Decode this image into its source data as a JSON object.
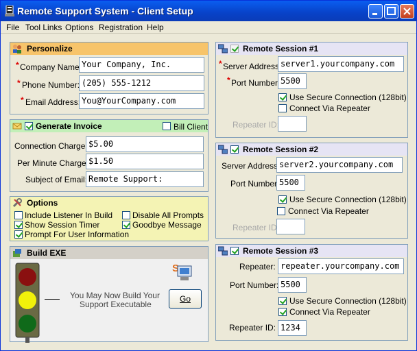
{
  "window": {
    "title": "Remote Support System - Client Setup"
  },
  "menu": [
    "File",
    "Tool Links",
    "Options",
    "Registration",
    "Help"
  ],
  "personalize": {
    "title": "Personalize",
    "company_label": "Company Name:",
    "company_value": "Your Company, Inc.",
    "phone_label": "Phone Number:",
    "phone_value": "(205) 555-1212",
    "email_label": "Email Address:",
    "email_value": "You@YourCompany.com"
  },
  "invoice": {
    "title": "Generate Invoice",
    "bill_client": "Bill Client",
    "connection_label": "Connection Charge:",
    "connection_value": "$5.00",
    "per_minute_label": "Per Minute Charge:",
    "per_minute_value": "$1.50",
    "subject_label": "Subject of Email:",
    "subject_value": "Remote Support:"
  },
  "options": {
    "title": "Options",
    "include_listener": "Include Listener In Build",
    "show_timer": "Show Session Timer",
    "prompt_user": "Prompt For User Information",
    "disable_prompts": "Disable All Prompts",
    "goodbye": "Goodbye Message"
  },
  "build": {
    "title": "Build EXE",
    "message_line1": "You May Now Build Your",
    "message_line2": "Support Executable",
    "go_label": "Go"
  },
  "session1": {
    "title": "Remote Session #1",
    "server_label": "Server Address:",
    "server_value": "server1.yourcompany.com",
    "port_label": "Port Number:",
    "port_value": "5500",
    "secure_label": "Use Secure Connection (128bit)",
    "repeater_label": "Connect Via Repeater",
    "repeater_id_label": "Repeater ID:",
    "repeater_id_value": ""
  },
  "session2": {
    "title": "Remote Session #2",
    "server_label": "Server Address:",
    "server_value": "server2.yourcompany.com",
    "port_label": "Port Number:",
    "port_value": "5500",
    "secure_label": "Use Secure Connection (128bit)",
    "repeater_label": "Connect Via Repeater",
    "repeater_id_label": "Repeater ID:",
    "repeater_id_value": ""
  },
  "session3": {
    "title": "Remote Session #3",
    "server_label": "Repeater:",
    "server_value": "repeater.yourcompany.com",
    "port_label": "Port Number:",
    "port_value": "5500",
    "secure_label": "Use Secure Connection (128bit)",
    "repeater_label": "Connect Via Repeater",
    "repeater_id_label": "Repeater ID:",
    "repeater_id_value": "1234"
  },
  "colors": {
    "personalize_header": "#f7c46a",
    "invoice_header": "#c2efb8",
    "options_header": "#f4f3b4",
    "build_header": "#d4d0c8",
    "session_header": "#e6e4f4"
  }
}
